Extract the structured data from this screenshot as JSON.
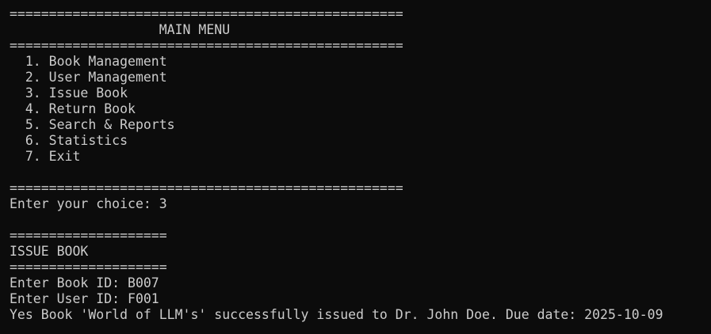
{
  "terminal": {
    "lines": [
      "==================================================",
      "                   MAIN MENU",
      "==================================================",
      "  1. Book Management",
      "  2. User Management",
      "  3. Issue Book",
      "  4. Return Book",
      "  5. Search & Reports",
      "  6. Statistics",
      "  7. Exit",
      "",
      "==================================================",
      "Enter your choice: 3",
      "",
      "====================",
      "ISSUE BOOK",
      "====================",
      "Enter Book ID: B007",
      "Enter User ID: F001",
      "Yes Book 'World of LLM's' successfully issued to Dr. John Doe. Due date: 2025-10-09"
    ],
    "colors": {
      "background": "#0c0c0c",
      "text": "#cccccc"
    }
  }
}
